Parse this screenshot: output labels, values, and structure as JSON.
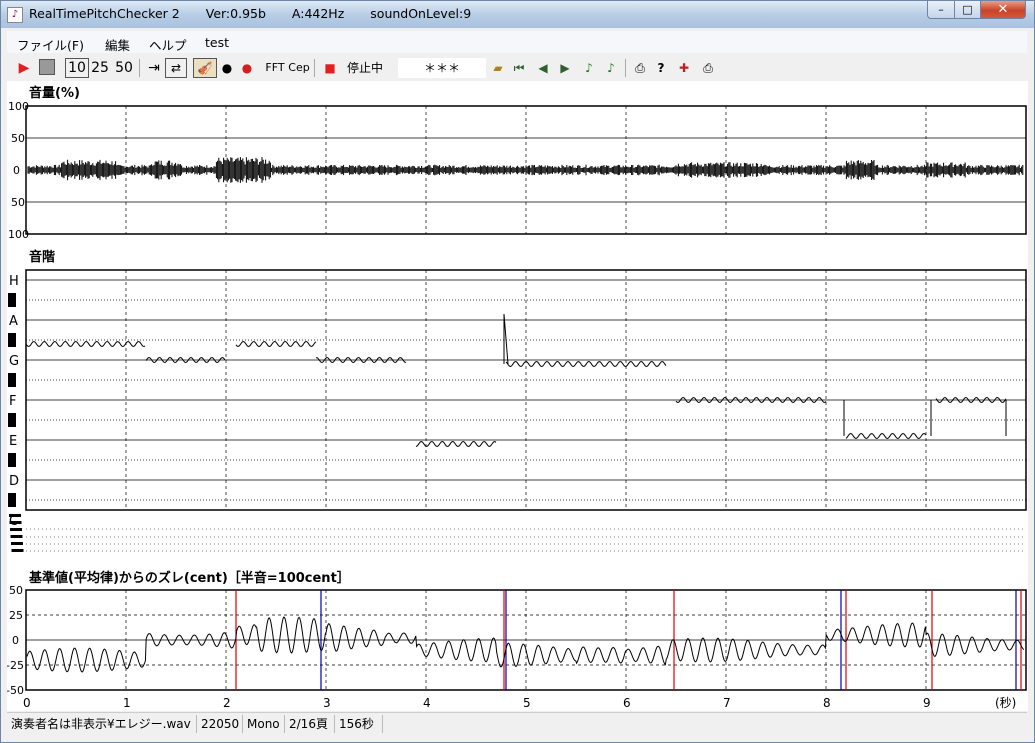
{
  "window": {
    "app_name": "RealTimePitchChecker 2",
    "version": "Ver:0.95b",
    "a_freq": "A:442Hz",
    "sound_on_level": "soundOnLevel:9",
    "minimize": "–",
    "maximize": "□",
    "close": "✕"
  },
  "menu": {
    "file": "ファイル(F)",
    "edit": "編集",
    "help": "ヘルプ",
    "test": "test"
  },
  "toolbar": {
    "play_icon": "play-icon",
    "stop_icon": "stop-icon",
    "speed_10": "10",
    "speed_25": "25",
    "speed_50": "50",
    "fft": "FFT",
    "cep": "Cep",
    "status": "停止中",
    "note_display": "＊＊＊"
  },
  "panels": {
    "volume": {
      "title": "音量(%)",
      "yticks": [
        "100",
        "50",
        "0",
        "50",
        "100"
      ]
    },
    "scale": {
      "title": "音階",
      "notes": [
        "H",
        "A",
        "G",
        "F",
        "E",
        "D",
        "C"
      ]
    },
    "cents": {
      "title": "基準値(平均律)からのズレ(cent)［半音=100cent］",
      "yticks": [
        "50",
        "25",
        "0",
        "-25",
        "-50"
      ]
    }
  },
  "xaxis": {
    "ticks": [
      "0",
      "1",
      "2",
      "3",
      "4",
      "5",
      "6",
      "7",
      "8",
      "9"
    ],
    "unit": "(秒)"
  },
  "statusbar": {
    "file": "演奏者名は非表示¥エレジー.wav",
    "rate": "22050",
    "channels": "Mono",
    "page": "2/16頁",
    "duration": "156秒"
  },
  "chart_data": {
    "type": "line",
    "x_range": [
      0,
      10
    ],
    "x_unit": "秒",
    "pitch_segments": [
      {
        "x": [
          0.0,
          1.2
        ],
        "note": "A-G#",
        "y_note_index": 1.6
      },
      {
        "x": [
          1.2,
          2.0
        ],
        "note": "G",
        "y_note_index": 2.0
      },
      {
        "x": [
          2.1,
          2.9
        ],
        "note": "A-G#",
        "y_note_index": 1.6
      },
      {
        "x": [
          2.9,
          3.8
        ],
        "note": "G",
        "y_note_index": 2.0
      },
      {
        "x": [
          3.9,
          4.7
        ],
        "note": "D#",
        "y_note_index": 4.1
      },
      {
        "x": [
          4.8,
          6.4
        ],
        "note": "G",
        "y_note_index": 2.1
      },
      {
        "x": [
          6.5,
          8.0
        ],
        "note": "F",
        "y_note_index": 3.0
      },
      {
        "x": [
          8.2,
          9.0
        ],
        "note": "E-D#",
        "y_note_index": 3.9
      },
      {
        "x": [
          9.1,
          9.8
        ],
        "note": "F",
        "y_note_index": 3.0
      }
    ],
    "cents_range": [
      -50,
      50
    ]
  }
}
